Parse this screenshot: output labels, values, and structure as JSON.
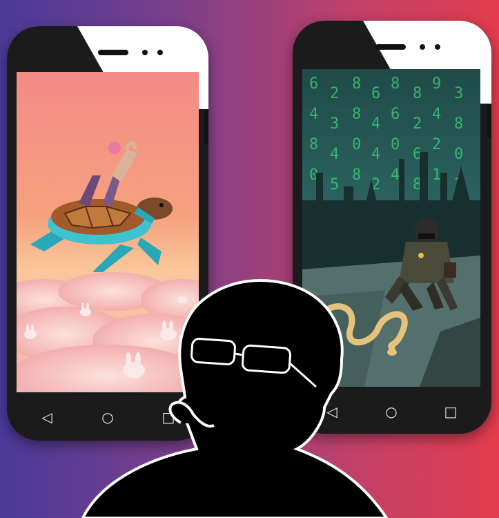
{
  "nav_icons": [
    "back-triangle-icon",
    "home-circle-icon",
    "recent-square-icon"
  ],
  "left_phone": {
    "nav": {
      "back": "◁",
      "home": "○",
      "recent": "□"
    },
    "screen_subject": "woman-riding-sea-turtle-over-pink-clouds"
  },
  "right_phone": {
    "nav": {
      "back": "◁",
      "home": "○",
      "recent": "□"
    },
    "screen_subject": "masked-soldier-with-snake-matrix-city",
    "matrix_digits": [
      "6",
      "4",
      "8",
      "0",
      "2",
      "3",
      "4",
      "5",
      "8",
      "8",
      "0",
      "8",
      "6",
      "4",
      "4",
      "2",
      "8",
      "6",
      "0",
      "4",
      "8",
      "2",
      "6",
      "8",
      "9",
      "4",
      "2",
      "1",
      "3",
      "8",
      "0",
      "2"
    ]
  },
  "colors": {
    "bg_left": "#4a3a9a",
    "bg_right": "#e23c4c",
    "phone_body": "#1b1b1b",
    "matrix_green": "#3fd27a"
  }
}
